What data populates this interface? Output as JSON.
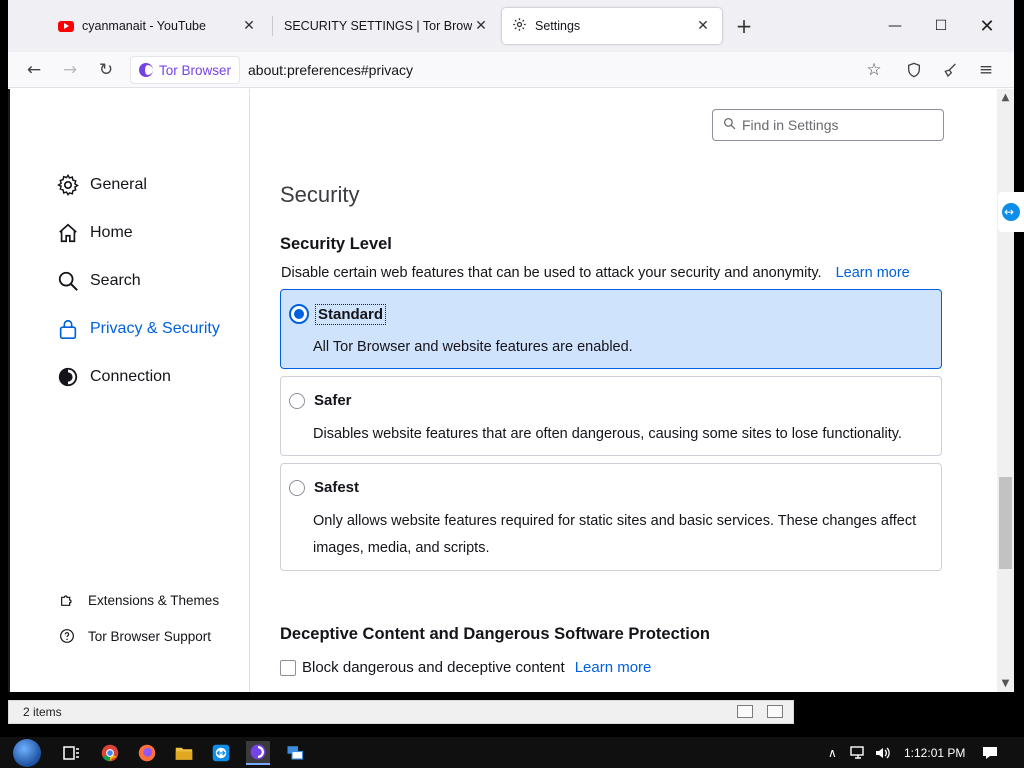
{
  "browser": {
    "tabs": [
      {
        "title": "cyanmanait - YouTube",
        "icon": "youtube-icon"
      },
      {
        "title": "SECURITY SETTINGS | Tor Browser M",
        "icon": "none"
      },
      {
        "title": "Settings",
        "icon": "gear-icon",
        "active": true
      }
    ],
    "url_identity": "Tor Browser",
    "url": "about:preferences#privacy"
  },
  "settings": {
    "search_placeholder": "Find in Settings",
    "categories": [
      {
        "label": "General",
        "icon": "gear-icon"
      },
      {
        "label": "Home",
        "icon": "home-icon"
      },
      {
        "label": "Search",
        "icon": "search-icon"
      },
      {
        "label": "Privacy & Security",
        "icon": "lock-icon",
        "selected": true
      },
      {
        "label": "Connection",
        "icon": "tor-onion-icon"
      }
    ],
    "footer_links": [
      {
        "label": "Extensions & Themes",
        "icon": "puzzle-icon"
      },
      {
        "label": "Tor Browser Support",
        "icon": "help-icon"
      }
    ],
    "section_title": "Security",
    "security_level": {
      "heading": "Security Level",
      "description": "Disable certain web features that can be used to attack your security and anonymity.",
      "learn_more": "Learn more",
      "options": [
        {
          "title": "Standard",
          "description": "All Tor Browser and website features are enabled.",
          "selected": true
        },
        {
          "title": "Safer",
          "description": "Disables website features that are often dangerous, causing some sites to lose functionality.",
          "selected": false
        },
        {
          "title": "Safest",
          "description": "Only allows website features required for static sites and basic services. These changes affect images, media, and scripts.",
          "selected": false
        }
      ]
    },
    "deceptive": {
      "heading": "Deceptive Content and Dangerous Software Protection",
      "checkbox_label": "Block dangerous and deceptive content",
      "checked": false,
      "learn_more": "Learn more"
    }
  },
  "explorer_status": {
    "items_count": "2 items"
  },
  "taskbar": {
    "clock": "1:12:01 PM"
  },
  "colors": {
    "accent": "#0061e0",
    "selected_bg": "#cfe3fc",
    "tor_purple": "#7542e5"
  }
}
